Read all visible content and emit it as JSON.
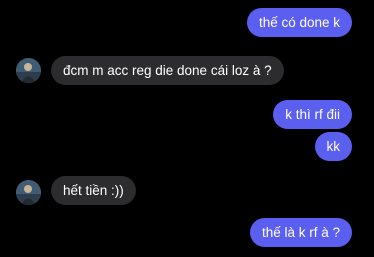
{
  "colors": {
    "background": "#000000",
    "outgoing_bubble": "#5b5ff0",
    "incoming_bubble": "#2c2c2e",
    "text": "#ffffff"
  },
  "messages": [
    {
      "direction": "outgoing",
      "text": "thế có done k"
    },
    {
      "direction": "incoming",
      "text": "đcm m acc reg die done cái loz à ?",
      "avatar": "contact-avatar"
    },
    {
      "direction": "outgoing",
      "text": "k thì rf đii"
    },
    {
      "direction": "outgoing",
      "text": "kk"
    },
    {
      "direction": "incoming",
      "text": "hết tiền :))",
      "avatar": "contact-avatar"
    },
    {
      "direction": "outgoing",
      "text": "thế là k rf à ?"
    }
  ]
}
